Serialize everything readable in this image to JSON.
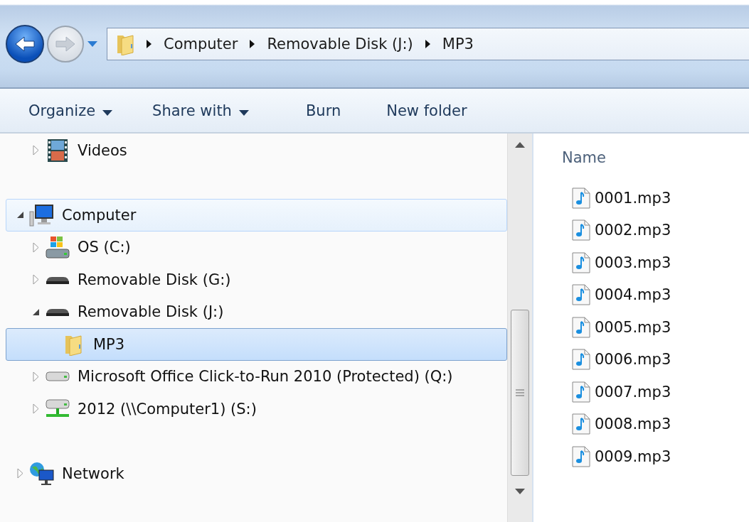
{
  "navigation": {
    "back": {
      "disabled": false
    },
    "forward": {
      "disabled": true
    }
  },
  "address_bar": {
    "crumbs": [
      "Computer",
      "Removable Disk (J:)",
      "MP3"
    ]
  },
  "toolbar": [
    {
      "label": "Organize",
      "dropdown": true
    },
    {
      "label": "Share with",
      "dropdown": true
    },
    {
      "label": "Burn",
      "dropdown": false
    },
    {
      "label": "New folder",
      "dropdown": false
    }
  ],
  "nav_tree": [
    {
      "children": [
        {
          "label": "Videos",
          "kind": "videos",
          "expanded": false,
          "selected": false,
          "hovered": false
        }
      ]
    },
    {
      "label": "Computer",
      "kind": "computer",
      "expanded": true,
      "selected": false,
      "hovered": true,
      "children": [
        {
          "label": "OS (C:)",
          "kind": "system-drive",
          "expanded": false,
          "selected": false,
          "hovered": false
        },
        {
          "label": "Removable Disk (G:)",
          "kind": "removable",
          "expanded": false,
          "selected": false,
          "hovered": false
        },
        {
          "label": "Removable Disk (J:)",
          "kind": "removable",
          "expanded": true,
          "selected": false,
          "hovered": false,
          "children": [
            {
              "label": "MP3",
              "kind": "folder",
              "selected": true,
              "hovered": false
            }
          ]
        },
        {
          "label": "Microsoft Office Click-to-Run 2010 (Protected) (Q:)",
          "kind": "hard-drive",
          "expanded": false,
          "selected": false,
          "hovered": false
        },
        {
          "label": "2012 (\\\\Computer1) (S:)",
          "kind": "network-drive",
          "expanded": false,
          "selected": false,
          "hovered": false
        }
      ]
    },
    {
      "label": "Network",
      "kind": "network",
      "expanded": false,
      "selected": false,
      "hovered": false
    }
  ],
  "file_list": {
    "columns": [
      "Name"
    ],
    "files": [
      {
        "name": "0001.mp3"
      },
      {
        "name": "0002.mp3"
      },
      {
        "name": "0003.mp3"
      },
      {
        "name": "0004.mp3"
      },
      {
        "name": "0005.mp3"
      },
      {
        "name": "0006.mp3"
      },
      {
        "name": "0007.mp3"
      },
      {
        "name": "0008.mp3"
      },
      {
        "name": "0009.mp3"
      }
    ]
  }
}
